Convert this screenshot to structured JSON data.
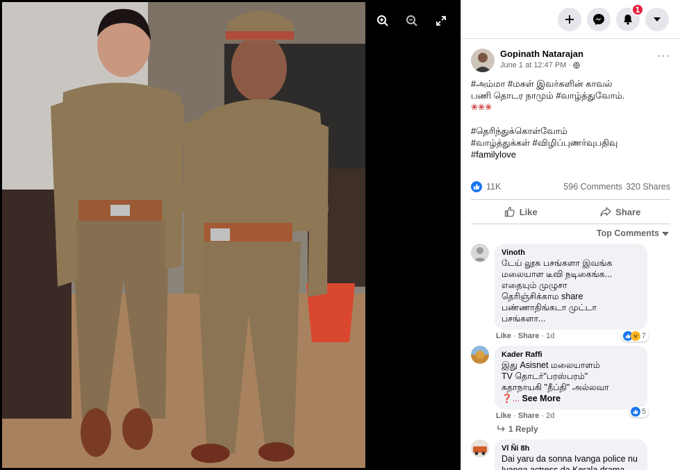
{
  "viewer": {
    "photo_alt": "Two women in khaki police uniforms standing in an office",
    "controls": [
      "zoom-in-icon",
      "zoom-out-icon",
      "fullscreen-icon"
    ]
  },
  "topbar": {
    "notification_count": "1"
  },
  "post": {
    "author": "Gopinath Natarajan",
    "timestamp": "June 1 at 12:47 PM",
    "more": "···",
    "text_line1": "#அம்மா #மகள் இவர்களின் காவல்",
    "text_line2": "பணி தொடர நாமும் #வாழ்த்துவோம்.",
    "text_emoji": "❀❀❀",
    "text_line3": "#தெரிந்துக்கொள்வோம்",
    "text_line4": "#வாழ்த்துக்கள் #விழிப்புணர்வுபதிவு",
    "text_line5": "#familylove",
    "likes": "11K",
    "comments": "596 Comments",
    "shares": "320 Shares"
  },
  "actions": {
    "like": "Like",
    "share": "Share"
  },
  "sort_label": "Top Comments",
  "comments": [
    {
      "name": "Vinoth",
      "lines": [
        "டேய் லூசு பசங்களா இவங்க",
        "மலையாள டீவி நடிகைங்க...",
        "எதையும் முழுசா",
        "தெரிஞ்சிக்காம share",
        "பண்ணாதிங்கடா முட்டா",
        "பசங்களா..."
      ],
      "like": "Like",
      "share": "Share",
      "time": "1d",
      "reactions": "7"
    },
    {
      "name": "Kader Raffi",
      "lines": [
        "இது Asisnet மலையாளம்",
        "TV தொடர்\"பரஸ்பரம்\"",
        "கதாநாயகி \"தீப்தி\" அல்லவா"
      ],
      "last_line": "❓... ",
      "see_more": "See More",
      "like": "Like",
      "share": "Share",
      "time": "2d",
      "reactions": "5",
      "reply": "1 Reply"
    },
    {
      "name": "Vî Ñi 8h",
      "lines": [
        "Dai yaru da sonna Ivanga police nu",
        "Ivanga actress da Kerala drama"
      ]
    }
  ]
}
